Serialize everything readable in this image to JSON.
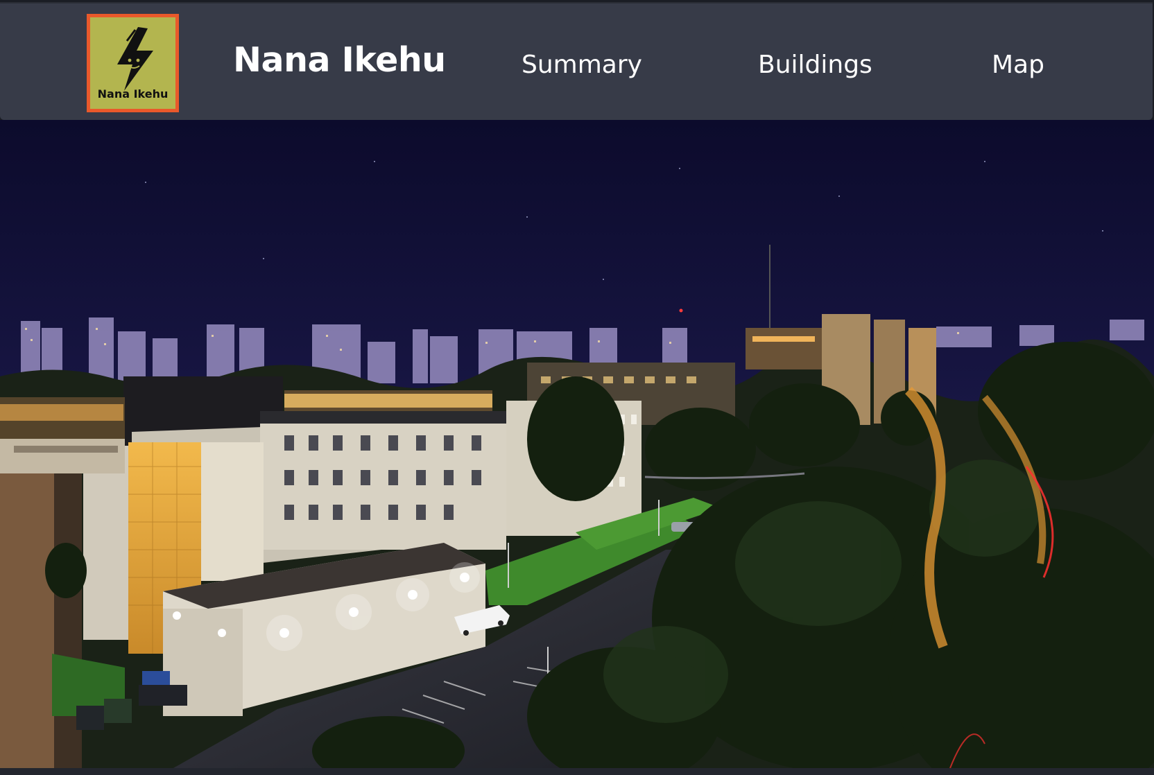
{
  "app": {
    "brand": "Nana Ikehu",
    "logo_text": "Nana Ikehu"
  },
  "nav": {
    "items": [
      {
        "label": "Summary"
      },
      {
        "label": "Buildings"
      },
      {
        "label": "Map"
      }
    ]
  },
  "hero": {
    "image_alt": "Night view of a campus with city skyline"
  },
  "colors": {
    "navbar_bg": "#373b48",
    "logo_bg": "#b3b54f",
    "logo_border": "#e9592b",
    "sky_top": "#0c0b2c",
    "sky_bottom": "#2a2263"
  },
  "icons": {
    "logo_mark": "lightning-bolt-icon"
  }
}
